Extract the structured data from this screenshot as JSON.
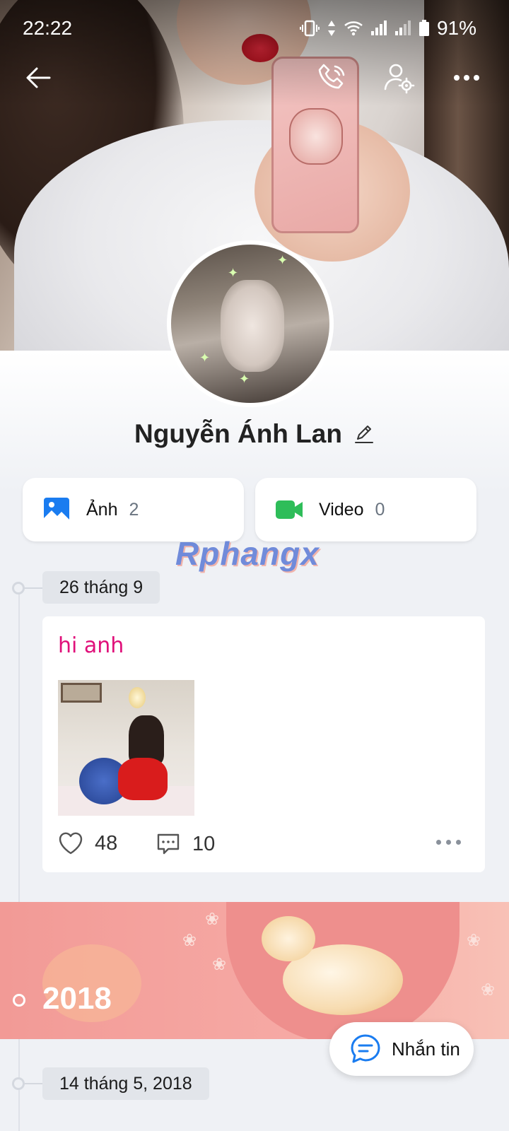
{
  "status_bar": {
    "time": "22:22",
    "battery_pct": "91%"
  },
  "header": {
    "back_icon": "arrow-left-icon",
    "call_icon": "phone-icon",
    "settings_icon": "user-settings-icon",
    "more_icon": "more-horizontal-icon"
  },
  "profile": {
    "name": "Nguyễn Ánh Lan"
  },
  "media": {
    "photos": {
      "label": "Ảnh",
      "count": "2"
    },
    "videos": {
      "label": "Video",
      "count": "0"
    }
  },
  "watermark": "Rphangx",
  "timeline": {
    "date_1": "26 tháng 9",
    "post": {
      "text": "hi anh",
      "likes": "48",
      "comments": "10"
    },
    "year_banner": "2018",
    "date_2": "14 tháng 5, 2018"
  },
  "fab": {
    "label": "Nhắn tin"
  },
  "colors": {
    "post_text": "#e0107a",
    "photo_icon": "#1a7cf0",
    "video_icon": "#2ebd59",
    "banner": "#f29a96"
  }
}
